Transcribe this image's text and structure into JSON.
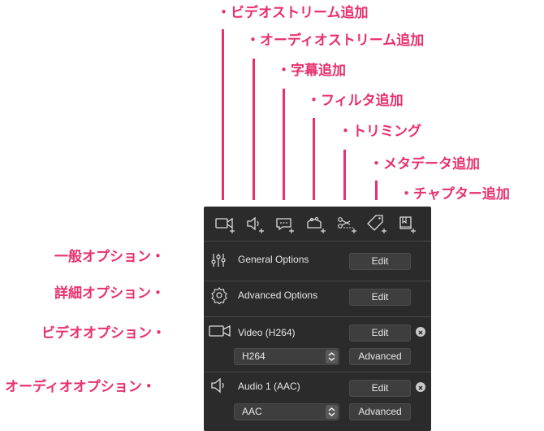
{
  "callouts": {
    "add_video_stream": "・ビデオストリーム追加",
    "add_audio_stream": "・オーディオストリーム追加",
    "add_subtitle": "・字幕追加",
    "add_filter": "・フィルタ追加",
    "trimming": "・トリミング",
    "add_metadata": "・メタデータ追加",
    "add_chapter": "・チャプター追加",
    "general_options": "一般オプション・",
    "advanced_options": "詳細オプション・",
    "video_options": "ビデオオプション・",
    "audio_options": "オーディオオプション・"
  },
  "toolbar": {
    "icons": [
      "video-add-icon",
      "audio-add-icon",
      "subtitle-add-icon",
      "filter-add-icon",
      "trim-icon",
      "metadata-tag-icon",
      "chapter-add-icon"
    ]
  },
  "general": {
    "label": "General Options",
    "edit_label": "Edit"
  },
  "advanced": {
    "label": "Advanced Options",
    "edit_label": "Edit"
  },
  "video": {
    "label": "Video (H264)",
    "edit_label": "Edit",
    "codec_value": "H264",
    "advanced_label": "Advanced"
  },
  "audio": {
    "label": "Audio 1 (AAC)",
    "edit_label": "Edit",
    "codec_value": "AAC",
    "advanced_label": "Advanced"
  },
  "colors": {
    "accent": "#e8306e",
    "panel_bg": "#2b2b2b"
  }
}
